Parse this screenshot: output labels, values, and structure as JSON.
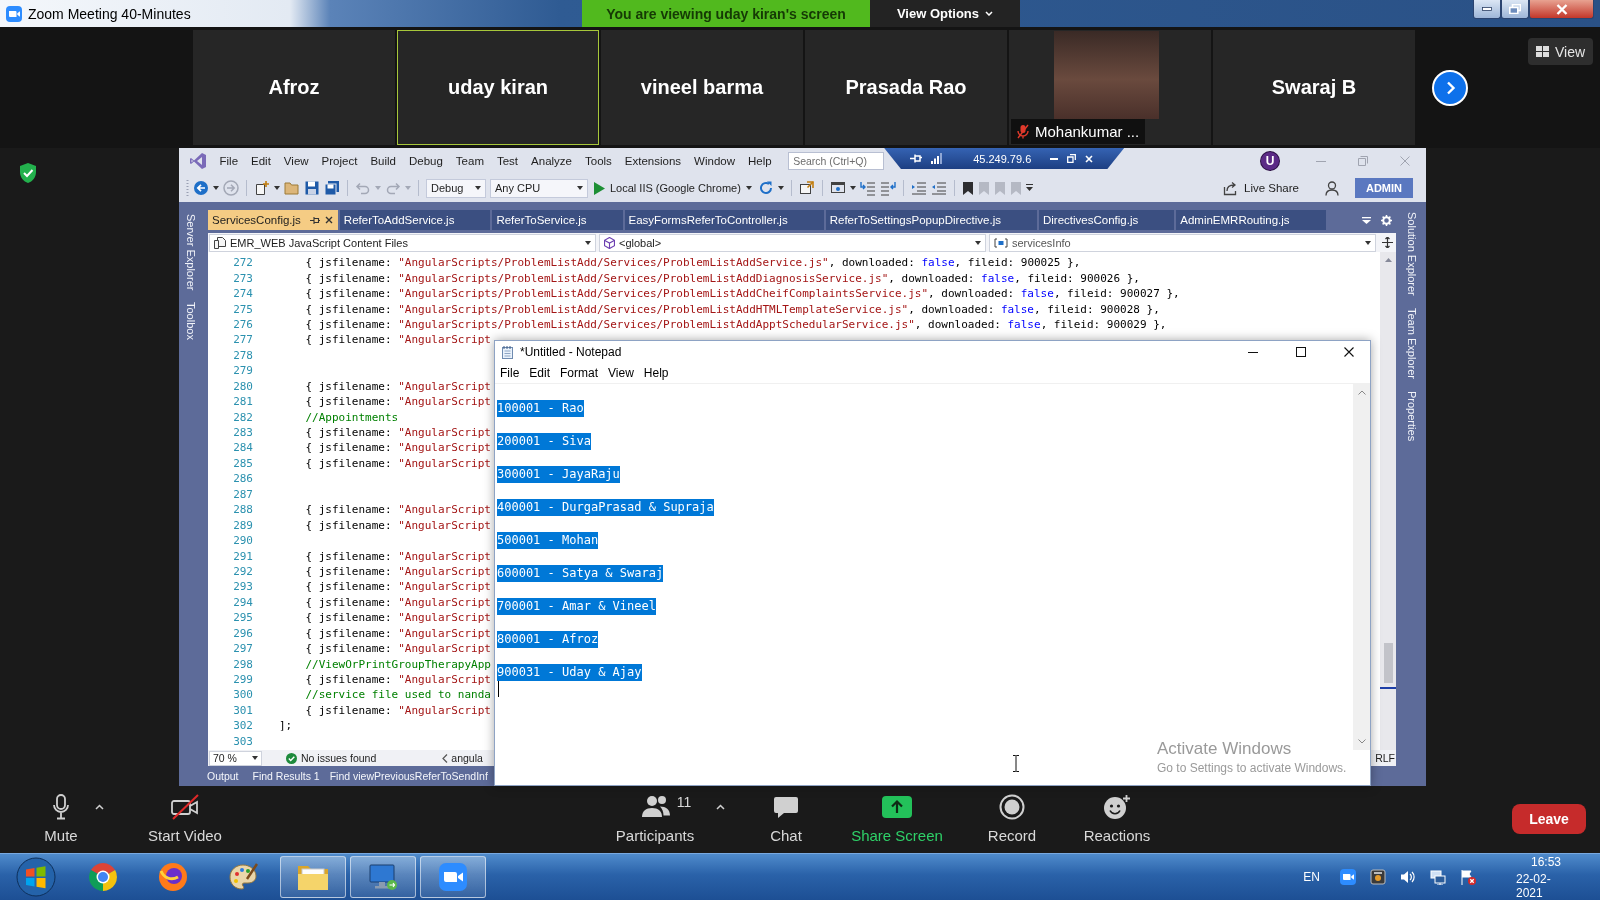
{
  "zoom_titlebar": {
    "title": "Zoom Meeting 40-Minutes",
    "share_banner": "You are viewing uday kiran's screen",
    "view_options": "View Options"
  },
  "participants": [
    {
      "kind": "name",
      "name": "Afroz",
      "active": false,
      "muted": false
    },
    {
      "kind": "name",
      "name": "uday kiran",
      "active": true,
      "muted": false
    },
    {
      "kind": "name",
      "name": "vineel barma",
      "active": false,
      "muted": false
    },
    {
      "kind": "name",
      "name": "Prasada Rao",
      "active": false,
      "muted": false
    },
    {
      "kind": "video",
      "name": "Mohankumar ...",
      "active": false,
      "muted": true
    },
    {
      "kind": "name",
      "name": "Swaraj B",
      "active": false,
      "muted": false
    }
  ],
  "view_button": "View",
  "visual_studio": {
    "menu": [
      "File",
      "Edit",
      "View",
      "Project",
      "Build",
      "Debug",
      "Team",
      "Test",
      "Analyze",
      "Tools",
      "Extensions",
      "Window",
      "Help"
    ],
    "search": {
      "placeholder": "Search (Ctrl+Q)"
    },
    "remote_address": "45.249.79.6",
    "account_initial": "U",
    "configuration": "Debug",
    "platform": "Any CPU",
    "run_target": "Local IIS (Google Chrome)",
    "live_share": "Live Share",
    "role_badge": "ADMIN",
    "left_panels": [
      "Server Explorer",
      "Toolbox"
    ],
    "right_panels": [
      "Solution Explorer",
      "Team Explorer",
      "Properties"
    ],
    "tabs": [
      {
        "label": "ServicesConfig.js",
        "selected": true
      },
      {
        "label": "ReferToAddService.js",
        "selected": false
      },
      {
        "label": "ReferToService.js",
        "selected": false
      },
      {
        "label": "EasyFormsReferToController.js",
        "selected": false
      },
      {
        "label": "ReferToSettingsPopupDirective.js",
        "selected": false
      },
      {
        "label": "DirectivesConfig.js",
        "selected": false
      },
      {
        "label": "AdminEMRRouting.js",
        "selected": false
      }
    ],
    "navigation": {
      "project": "EMR_WEB JavaScript Content Files",
      "scope": "<global>",
      "member": "servicesInfo"
    },
    "code_lines": [
      {
        "number": "272",
        "segments": [
          {
            "kind": "plain",
            "text": "    { jsfilename: "
          },
          {
            "kind": "string",
            "text": "\"AngularScripts/ProblemListAdd/Services/ProblemListAddService.js\""
          },
          {
            "kind": "plain",
            "text": ", downloaded: "
          },
          {
            "kind": "keyword",
            "text": "false"
          },
          {
            "kind": "plain",
            "text": ", fileid: 900025 },"
          }
        ]
      },
      {
        "number": "273",
        "segments": [
          {
            "kind": "plain",
            "text": "    { jsfilename: "
          },
          {
            "kind": "string",
            "text": "\"AngularScripts/ProblemListAdd/Services/ProblemListAddDiagnosisService.js\""
          },
          {
            "kind": "plain",
            "text": ", downloaded: "
          },
          {
            "kind": "keyword",
            "text": "false"
          },
          {
            "kind": "plain",
            "text": ", fileid: 900026 },"
          }
        ]
      },
      {
        "number": "274",
        "segments": [
          {
            "kind": "plain",
            "text": "    { jsfilename: "
          },
          {
            "kind": "string",
            "text": "\"AngularScripts/ProblemListAdd/Services/ProblemListAddCheifComplaintsService.js\""
          },
          {
            "kind": "plain",
            "text": ", downloaded: "
          },
          {
            "kind": "keyword",
            "text": "false"
          },
          {
            "kind": "plain",
            "text": ", fileid: 900027 },"
          }
        ]
      },
      {
        "number": "275",
        "segments": [
          {
            "kind": "plain",
            "text": "    { jsfilename: "
          },
          {
            "kind": "string",
            "text": "\"AngularScripts/ProblemListAdd/Services/ProblemListAddHTMLTemplateService.js\""
          },
          {
            "kind": "plain",
            "text": ", downloaded: "
          },
          {
            "kind": "keyword",
            "text": "false"
          },
          {
            "kind": "plain",
            "text": ", fileid: 900028 },"
          }
        ]
      },
      {
        "number": "276",
        "segments": [
          {
            "kind": "plain",
            "text": "    { jsfilename: "
          },
          {
            "kind": "string",
            "text": "\"AngularScripts/ProblemListAdd/Services/ProblemListAddApptSchedularService.js\""
          },
          {
            "kind": "plain",
            "text": ", downloaded: "
          },
          {
            "kind": "keyword",
            "text": "false"
          },
          {
            "kind": "plain",
            "text": ", fileid: 900029 },"
          }
        ]
      },
      {
        "number": "277",
        "segments": [
          {
            "kind": "plain",
            "text": "    { jsfilename: "
          },
          {
            "kind": "string",
            "text": "\"AngularScript"
          }
        ]
      },
      {
        "number": "278"
      },
      {
        "number": "279"
      },
      {
        "number": "280",
        "segments": [
          {
            "kind": "plain",
            "text": "    { jsfilename: "
          },
          {
            "kind": "string",
            "text": "\"AngularScript"
          }
        ]
      },
      {
        "number": "281",
        "segments": [
          {
            "kind": "plain",
            "text": "    { jsfilename: "
          },
          {
            "kind": "string",
            "text": "\"AngularScript"
          }
        ]
      },
      {
        "number": "282",
        "segments": [
          {
            "kind": "comment",
            "text": "    //Appointments"
          }
        ]
      },
      {
        "number": "283",
        "segments": [
          {
            "kind": "plain",
            "text": "    { jsfilename: "
          },
          {
            "kind": "string",
            "text": "\"AngularScript"
          }
        ]
      },
      {
        "number": "284",
        "segments": [
          {
            "kind": "plain",
            "text": "    { jsfilename: "
          },
          {
            "kind": "string",
            "text": "\"AngularScript"
          }
        ]
      },
      {
        "number": "285",
        "segments": [
          {
            "kind": "plain",
            "text": "    { jsfilename: "
          },
          {
            "kind": "string",
            "text": "\"AngularScript"
          }
        ]
      },
      {
        "number": "286"
      },
      {
        "number": "287"
      },
      {
        "number": "288",
        "segments": [
          {
            "kind": "plain",
            "text": "    { jsfilename: "
          },
          {
            "kind": "string",
            "text": "\"AngularScript"
          }
        ]
      },
      {
        "number": "289",
        "segments": [
          {
            "kind": "plain",
            "text": "    { jsfilename: "
          },
          {
            "kind": "string",
            "text": "\"AngularScript"
          }
        ]
      },
      {
        "number": "290"
      },
      {
        "number": "291",
        "segments": [
          {
            "kind": "plain",
            "text": "    { jsfilename: "
          },
          {
            "kind": "string",
            "text": "\"AngularScript"
          }
        ]
      },
      {
        "number": "292",
        "segments": [
          {
            "kind": "plain",
            "text": "    { jsfilename: "
          },
          {
            "kind": "string",
            "text": "\"AngularScript"
          }
        ]
      },
      {
        "number": "293",
        "segments": [
          {
            "kind": "plain",
            "text": "    { jsfilename: "
          },
          {
            "kind": "string",
            "text": "\"AngularScript"
          }
        ]
      },
      {
        "number": "294",
        "segments": [
          {
            "kind": "plain",
            "text": "    { jsfilename: "
          },
          {
            "kind": "string",
            "text": "\"AngularScript"
          }
        ]
      },
      {
        "number": "295",
        "segments": [
          {
            "kind": "plain",
            "text": "    { jsfilename: "
          },
          {
            "kind": "string",
            "text": "\"AngularScript"
          }
        ]
      },
      {
        "number": "296",
        "segments": [
          {
            "kind": "plain",
            "text": "    { jsfilename: "
          },
          {
            "kind": "string",
            "text": "\"AngularScript"
          }
        ]
      },
      {
        "number": "297",
        "segments": [
          {
            "kind": "plain",
            "text": "    { jsfilename: "
          },
          {
            "kind": "string",
            "text": "\"AngularScript"
          }
        ]
      },
      {
        "number": "298",
        "segments": [
          {
            "kind": "comment",
            "text": "    //ViewOrPrintGroupTherapyApp"
          }
        ]
      },
      {
        "number": "299",
        "segments": [
          {
            "kind": "plain",
            "text": "    { jsfilename: "
          },
          {
            "kind": "string",
            "text": "\"AngularScript"
          }
        ]
      },
      {
        "number": "300",
        "segments": [
          {
            "kind": "comment",
            "text": "    //service file used to nanda"
          }
        ]
      },
      {
        "number": "301",
        "segments": [
          {
            "kind": "plain",
            "text": "    { jsfilename: "
          },
          {
            "kind": "string",
            "text": "\"AngularScript"
          }
        ]
      },
      {
        "number": "302",
        "segments": [
          {
            "kind": "plain",
            "text": "];"
          }
        ]
      },
      {
        "number": "303"
      }
    ],
    "editor_status": {
      "zoom": "70 %",
      "issues": "No issues found",
      "context": "angula",
      "line_ending": "RLF"
    },
    "tool_tabs": [
      "Output",
      "Find Results 1",
      "Find viewPreviousReferToSendInf"
    ]
  },
  "notepad": {
    "title": "*Untitled - Notepad",
    "menu": [
      "File",
      "Edit",
      "Format",
      "View",
      "Help"
    ],
    "lines": [
      {
        "text": "100001 - Rao",
        "selected": true
      },
      {
        "text": "200001 - Siva",
        "selected": true
      },
      {
        "text": "300001 - JayaRaju",
        "selected": true
      },
      {
        "text": "400001 - DurgaPrasad & Supraja",
        "selected": true
      },
      {
        "text": "500001 - Mohan",
        "selected": true
      },
      {
        "text": "600001 - Satya & Swaraj",
        "selected": true
      },
      {
        "text": "700001 - Amar & Vineel",
        "selected": true
      },
      {
        "text": "800001 - Afroz",
        "selected": true
      },
      {
        "text": "900031 - Uday & Ajay",
        "selected": true
      }
    ]
  },
  "activation_notice": {
    "title": "Activate Windows",
    "hint": "Go to Settings to activate Windows."
  },
  "meeting_controls": {
    "left": [
      {
        "kind": "mute",
        "label": "Mute"
      },
      {
        "kind": "video",
        "label": "Start Video"
      }
    ],
    "center": [
      {
        "kind": "participants",
        "label": "Participants",
        "count": "11"
      },
      {
        "kind": "chat",
        "label": "Chat"
      },
      {
        "kind": "share",
        "label": "Share Screen"
      },
      {
        "kind": "record",
        "label": "Record"
      },
      {
        "kind": "reactions",
        "label": "Reactions"
      }
    ],
    "leave": "Leave"
  },
  "taskbar": {
    "apps": [
      {
        "kind": "chrome",
        "running": false
      },
      {
        "kind": "firefox",
        "running": false
      },
      {
        "kind": "paint",
        "running": false
      },
      {
        "kind": "explorer",
        "running": true
      },
      {
        "kind": "remote_desktop",
        "running": true
      },
      {
        "kind": "zoom",
        "running": true
      }
    ],
    "language": "EN",
    "time": "16:53",
    "date": "22-02-2021"
  }
}
